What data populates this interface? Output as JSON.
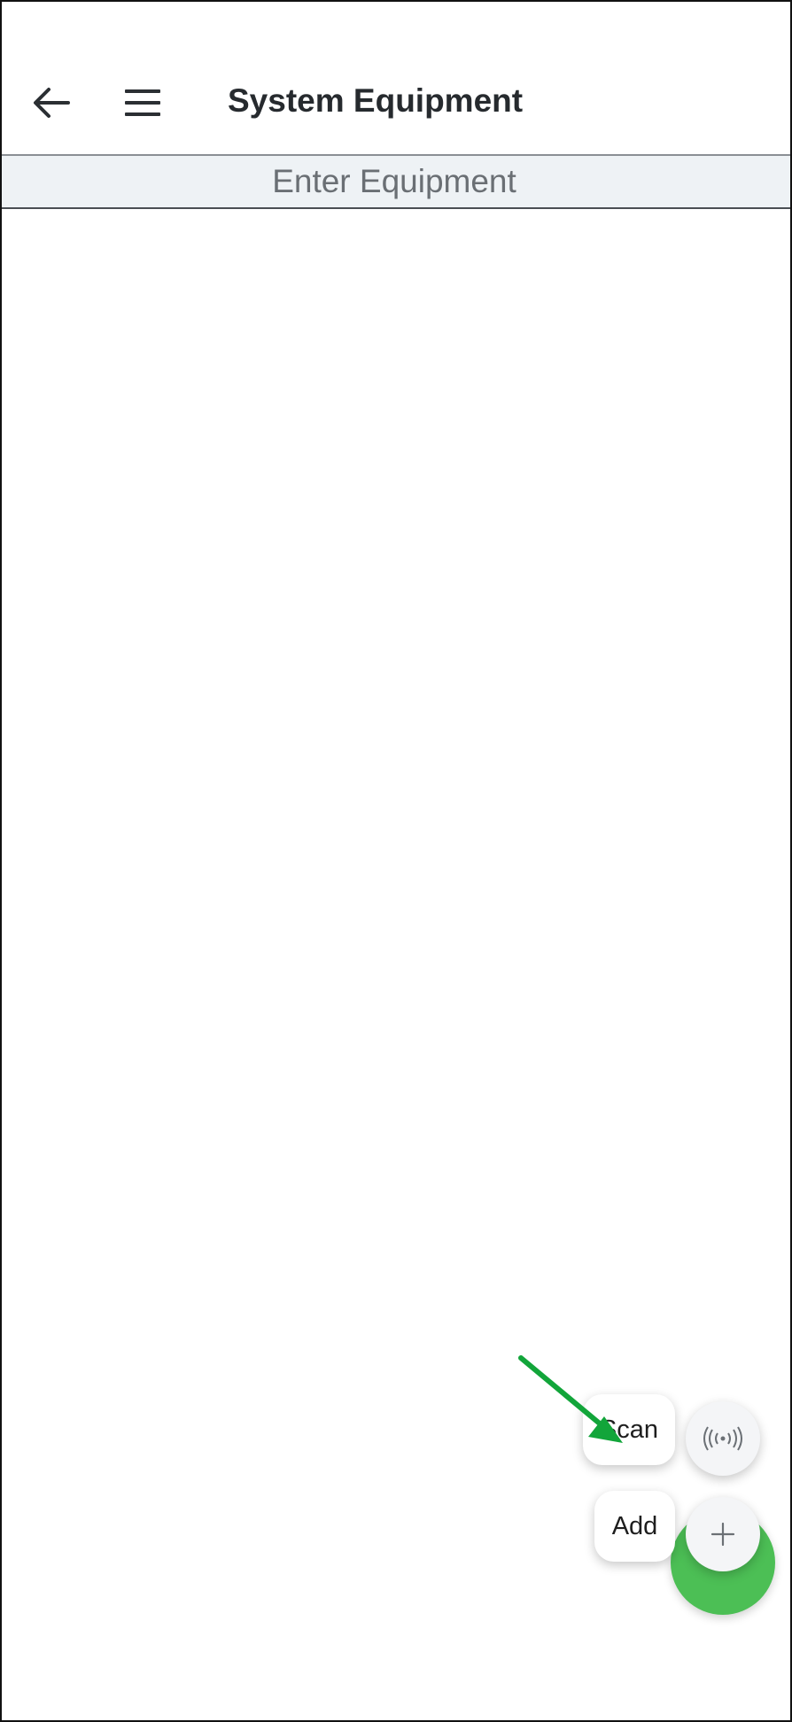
{
  "app_bar": {
    "title": "System Equipment",
    "back_icon": "arrow-left-icon",
    "menu_icon": "hamburger-menu-icon"
  },
  "sub_header": {
    "label": "Enter Equipment"
  },
  "speed_dial": {
    "scan_label": "Scan",
    "scan_icon": "broadcast-signal-icon",
    "add_label": "Add",
    "add_icon": "plus-icon",
    "main_color": "#4cbf55"
  },
  "annotation": {
    "arrow_color": "#12a53a"
  }
}
